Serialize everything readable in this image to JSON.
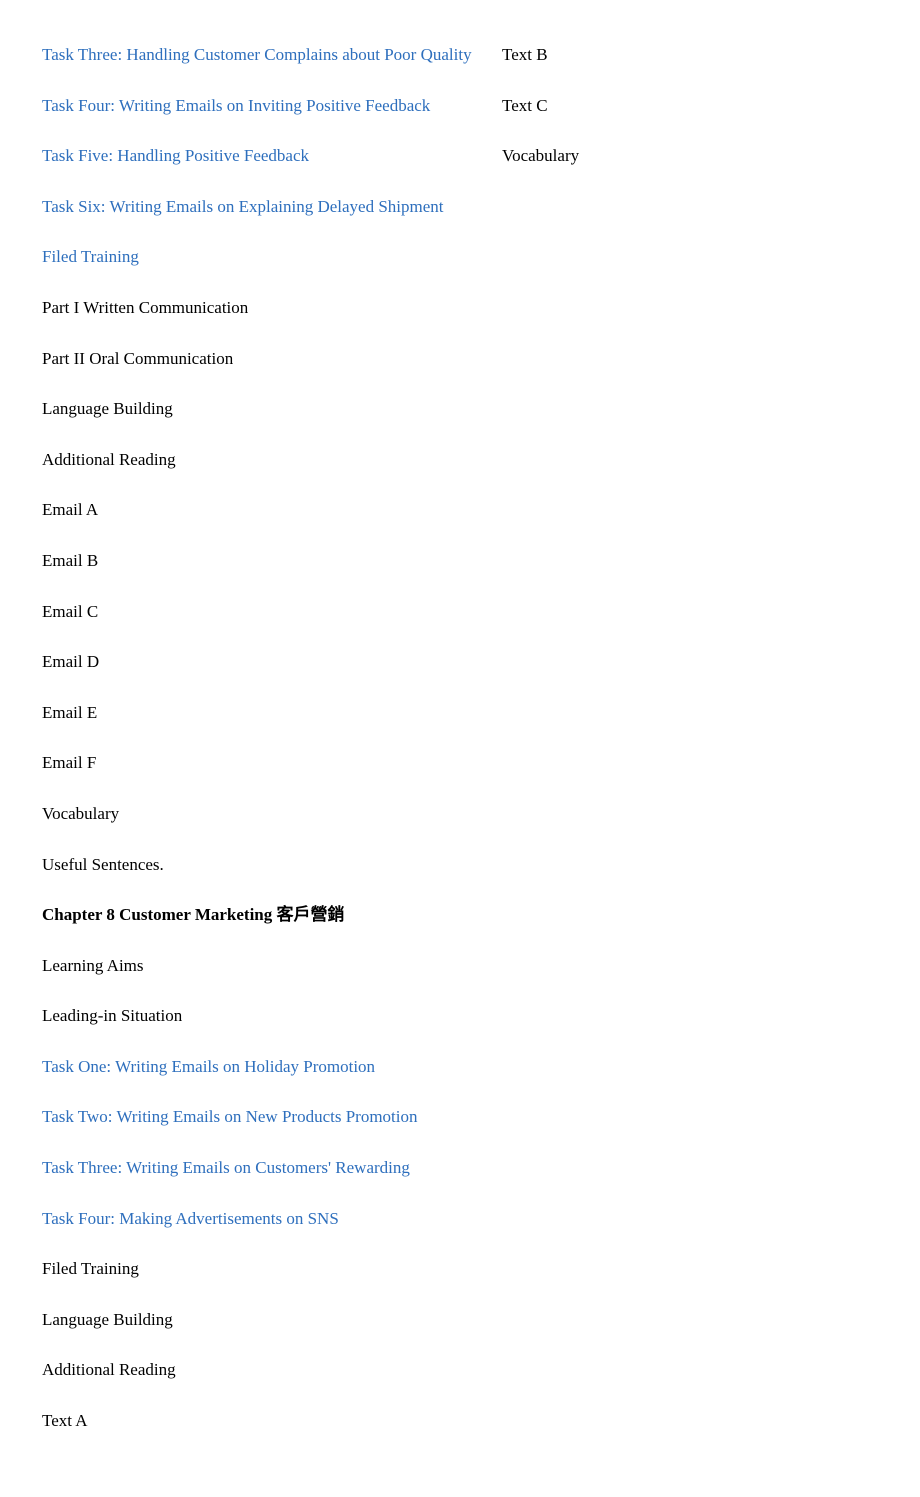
{
  "left": [
    {
      "text": "Task Three: Handling Customer Complains about Poor Quality",
      "style": "link"
    },
    {
      "text": "Task Four: Writing Emails on Inviting Positive Feedback",
      "style": "link"
    },
    {
      "text": "Task Five: Handling Positive Feedback",
      "style": "link"
    },
    {
      "text": "Task Six: Writing Emails on Explaining Delayed Shipment",
      "style": "link"
    },
    {
      "text": "Filed Training",
      "style": "link"
    },
    {
      "text": "Part I Written Communication",
      "style": "plain"
    },
    {
      "text": "Part II Oral Communication",
      "style": "plain"
    },
    {
      "text": "Language Building",
      "style": "plain"
    },
    {
      "text": "Additional Reading",
      "style": "plain"
    },
    {
      "text": "Email A",
      "style": "plain"
    },
    {
      "text": "Email B",
      "style": "plain"
    },
    {
      "text": "Email C",
      "style": "plain"
    },
    {
      "text": "Email D",
      "style": "plain"
    },
    {
      "text": "Email E",
      "style": "plain"
    },
    {
      "text": "Email F",
      "style": "plain"
    },
    {
      "text": "Vocabulary",
      "style": "plain"
    },
    {
      "text": "Useful Sentences.",
      "style": "plain"
    },
    {
      "text": "Chapter 8 Customer Marketing 客戶營銷",
      "style": "bold"
    },
    {
      "text": "Learning Aims",
      "style": "plain"
    },
    {
      "text": "Leading-in Situation",
      "style": "plain"
    },
    {
      "text": "Task One: Writing Emails on Holiday Promotion",
      "style": "link"
    },
    {
      "text": "Task Two: Writing Emails on New Products Promotion",
      "style": "link"
    },
    {
      "text": "Task Three: Writing Emails on Customers' Rewarding",
      "style": "link"
    },
    {
      "text": "Task Four: Making Advertisements on SNS",
      "style": "link"
    },
    {
      "text": "Filed Training",
      "style": "plain"
    },
    {
      "text": "Language Building",
      "style": "plain"
    },
    {
      "text": "Additional Reading",
      "style": "plain"
    },
    {
      "text": "Text A",
      "style": "plain"
    }
  ],
  "right": [
    {
      "text": "Text B",
      "style": "plain"
    },
    {
      "text": "Text C",
      "style": "plain"
    },
    {
      "text": "Vocabulary",
      "style": "plain"
    }
  ]
}
